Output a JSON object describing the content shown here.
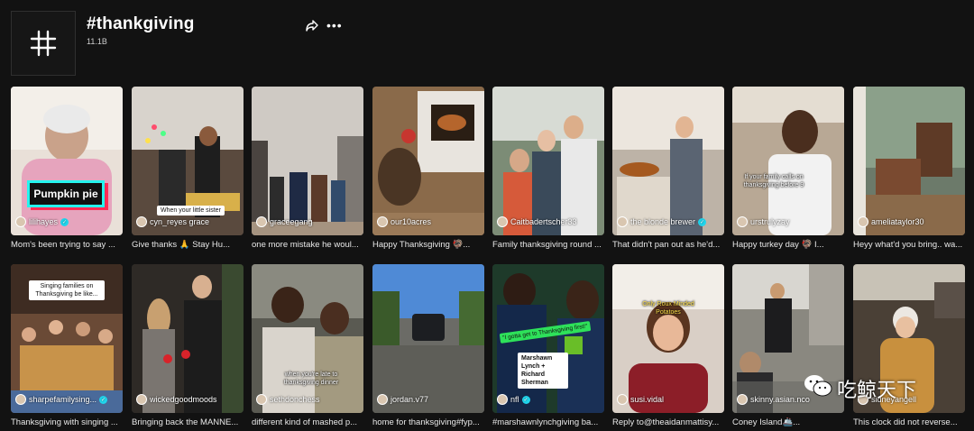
{
  "header": {
    "title": "#thankgiving",
    "views": "11.1B",
    "hash_icon": "hashtag-icon",
    "share_icon": "share-icon",
    "more_icon": "more-icon"
  },
  "videos": [
    {
      "author": "lilihayes",
      "verified": true,
      "caption": "Mom's been trying to say ...",
      "overlay": "Pumpkin pie"
    },
    {
      "author": "cyn_reyes grace",
      "verified": false,
      "caption": "Give thanks 🙏 Stay Hu...",
      "overlay": "When your little sister"
    },
    {
      "author": "graceegang",
      "verified": false,
      "caption": "one more mistake he woul...",
      "overlay": ""
    },
    {
      "author": "our10acres",
      "verified": false,
      "caption": "Happy Thanksgiving 🦃...",
      "overlay": ""
    },
    {
      "author": "Caitbadertscher33",
      "verified": false,
      "caption": "Family thanksgiving round ...",
      "overlay": ""
    },
    {
      "author": "the blonde brewer",
      "verified": true,
      "caption": "That didn't pan out as he'd...",
      "overlay": ""
    },
    {
      "author": "urstrulyzay",
      "verified": false,
      "caption": "Happy turkey day 🦃 I...",
      "overlay": "If your family calls on thanksgiving before 9"
    },
    {
      "author": "ameliataylor30",
      "verified": false,
      "caption": "Heyy what'd you bring.. wa...",
      "overlay": ""
    },
    {
      "author": "sharpefamilysing...",
      "verified": true,
      "caption": "Thanksgiving with singing ...",
      "overlay": "Singing families on Thanksgiving be like..."
    },
    {
      "author": "wickedgoodmoods",
      "verified": false,
      "caption": "Bringing back the MANNE...",
      "overlay": ""
    },
    {
      "author": "sethdonchess",
      "verified": false,
      "caption": "different kind of mashed p...",
      "overlay": "when you're late to thanksgiving dinner"
    },
    {
      "author": "jordan.v77",
      "verified": false,
      "caption": "home for thanksgiving#fyp...",
      "overlay": ""
    },
    {
      "author": "nfl",
      "verified": true,
      "caption": "#marshawnlynchgiving ba...",
      "overlay": "Marshawn Lynch + Richard Sherman"
    },
    {
      "author": "susi.vidal",
      "verified": false,
      "caption": "Reply to@theaidanmattisy...",
      "overlay": "Only Roux Minded Potatoes"
    },
    {
      "author": "skinny.asian.nco",
      "verified": false,
      "caption": "Coney Island🚢...",
      "overlay": ""
    },
    {
      "author": "sidneyangell",
      "verified": false,
      "caption": "This clock did not reverse...",
      "overlay": ""
    }
  ],
  "watermark": {
    "text": "吃鲸天下",
    "icon": "wechat-icon"
  },
  "colors": {
    "background": "#121212",
    "accent_cyan": "#25f4ee",
    "accent_pink": "#fe2c55",
    "verified": "#20d5ec"
  }
}
